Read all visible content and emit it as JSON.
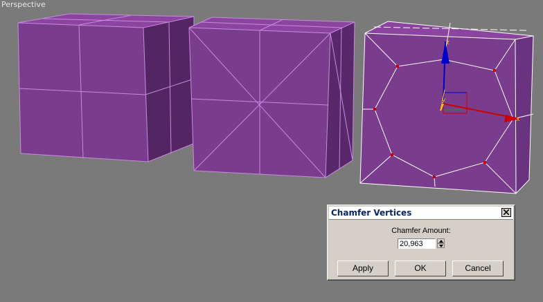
{
  "viewport": {
    "label": "Perspective"
  },
  "dialog": {
    "title": "Chamfer Vertices",
    "amount_label": "Chamfer Amount:",
    "amount_value": "20,963",
    "buttons": {
      "apply": "Apply",
      "ok": "OK",
      "cancel": "Cancel"
    }
  },
  "colors": {
    "viewport_bg": "#7a7a7a",
    "mesh_face": "#7a3a8c",
    "mesh_edge": "#cc88e8",
    "selected_edge": "#ffffff",
    "vertex": "#cc0000",
    "gizmo_x": "#cc0000",
    "gizmo_y": "#0000cc",
    "gizmo_z": "#ffcc00"
  }
}
